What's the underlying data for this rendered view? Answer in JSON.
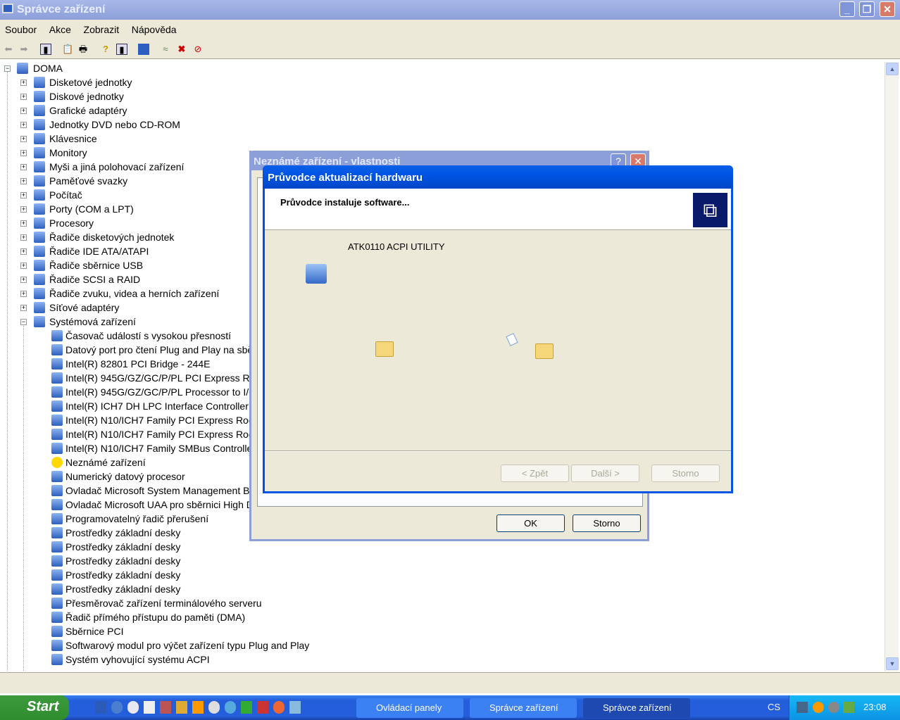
{
  "window": {
    "title": "Správce zařízení"
  },
  "menu": [
    "Soubor",
    "Akce",
    "Zobrazit",
    "Nápověda"
  ],
  "tree": {
    "root": "DOMA",
    "categories": [
      "Disketové jednotky",
      "Diskové jednotky",
      "Grafické adaptéry",
      "Jednotky DVD nebo CD-ROM",
      "Klávesnice",
      "Monitory",
      "Myši a jiná polohovací zařízení",
      "Paměťové svazky",
      "Počítač",
      "Porty (COM a LPT)",
      "Procesory",
      "Řadiče disketových jednotek",
      "Řadiče IDE ATA/ATAPI",
      "Řadiče sběrnice USB",
      "Řadiče SCSI a RAID",
      "Řadiče zvuku, videa a herních zařízení",
      "Síťové adaptéry",
      "Systémová zařízení"
    ],
    "system_devices": [
      "Časovač událostí s vysokou přesností",
      "Datový port pro čtení Plug and Play na sběrnici ISA",
      "Intel(R) 82801 PCI Bridge - 244E",
      "Intel(R) 945G/GZ/GC/P/PL PCI Express Root Port - 2771",
      "Intel(R) 945G/GZ/GC/P/PL Processor to I/O Controller - 2770",
      "Intel(R) ICH7 DH LPC Interface Controller - 27B0",
      "Intel(R) N10/ICH7 Family PCI Express Root Port - 27D0",
      "Intel(R) N10/ICH7 Family PCI Express Root Port - 27D2",
      "Intel(R) N10/ICH7 Family SMBus Controller - 27DA",
      "Neznámé zařízení",
      "Numerický datový procesor",
      "Ovladač Microsoft System Management BIOS",
      "Ovladač Microsoft UAA pro sběrnici High Definition Audio",
      "Programovatelný řadič přerušení",
      "Prostředky základní desky",
      "Prostředky základní desky",
      "Prostředky základní desky",
      "Prostředky základní desky",
      "Prostředky základní desky",
      "Přesměrovač zařízení terminálového serveru",
      "Řadič přímého přístupu do paměti (DMA)",
      "Sběrnice PCI",
      "Softwarový modul pro výčet zařízení typu Plug and Play",
      "Systém vyhovující systému ACPI"
    ]
  },
  "props_dialog": {
    "title": "Neznámé zařízení - vlastnosti",
    "ok": "OK",
    "cancel": "Storno"
  },
  "wizard": {
    "title": "Průvodce aktualizací hardwaru",
    "heading": "Průvodce instaluje software...",
    "device": "ATK0110 ACPI UTILITY",
    "back": "< Zpět",
    "next": "Další >",
    "cancel": "Storno"
  },
  "taskbar": {
    "start": "Start",
    "tasks": [
      "Ovládací panely",
      "Správce zařízení",
      "Správce zařízení"
    ],
    "language": "CS",
    "clock": "23:08"
  }
}
